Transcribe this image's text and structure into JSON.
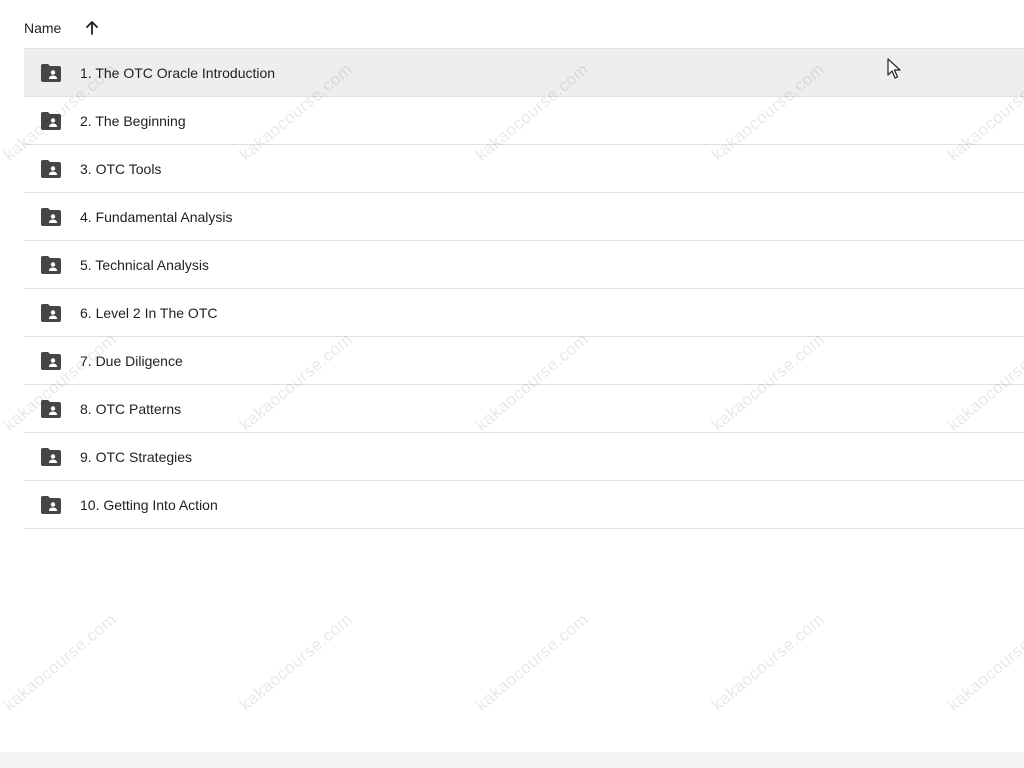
{
  "header": {
    "name_label": "Name",
    "sort_icon": "arrow-up-icon"
  },
  "folders": [
    {
      "label": "1. The OTC Oracle Introduction",
      "icon": "shared-folder-icon",
      "selected": true
    },
    {
      "label": "2. The Beginning",
      "icon": "shared-folder-icon",
      "selected": false
    },
    {
      "label": "3. OTC Tools",
      "icon": "shared-folder-icon",
      "selected": false
    },
    {
      "label": "4. Fundamental Analysis",
      "icon": "shared-folder-icon",
      "selected": false
    },
    {
      "label": "5. Technical Analysis",
      "icon": "shared-folder-icon",
      "selected": false
    },
    {
      "label": "6. Level 2 In The OTC",
      "icon": "shared-folder-icon",
      "selected": false
    },
    {
      "label": "7. Due Diligence",
      "icon": "shared-folder-icon",
      "selected": false
    },
    {
      "label": "8. OTC Patterns",
      "icon": "shared-folder-icon",
      "selected": false
    },
    {
      "label": "9. OTC Strategies",
      "icon": "shared-folder-icon",
      "selected": false
    },
    {
      "label": "10. Getting Into Action",
      "icon": "shared-folder-icon",
      "selected": false
    }
  ],
  "watermark": "kakaocourse.com",
  "colors": {
    "selected_row": "#eeeeee",
    "divider": "#e0e0e0",
    "icon": "#444746",
    "text": "#1f1f1f"
  }
}
